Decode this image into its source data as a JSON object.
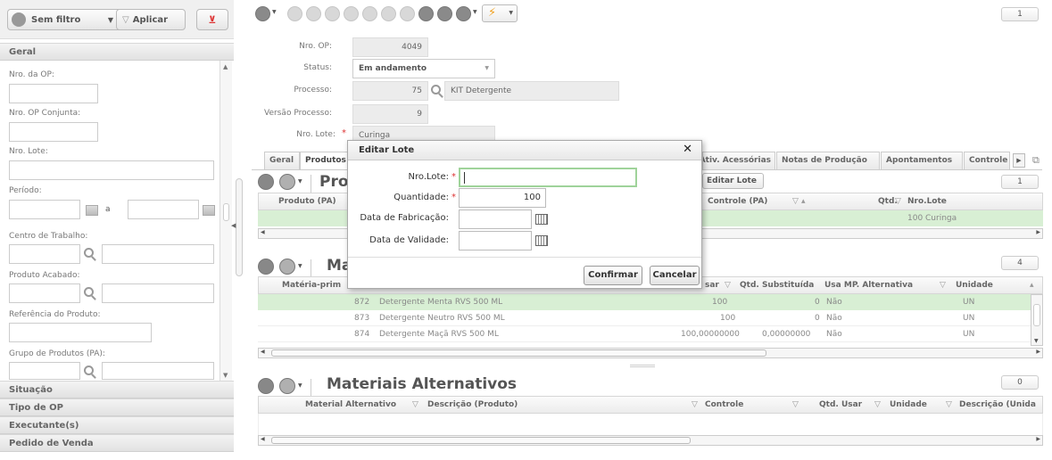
{
  "filter_bar": {
    "filter_label": "Sem filtro",
    "apply_label": "Aplicar"
  },
  "left_panel": {
    "geral_header": "Geral",
    "fields": {
      "nro_op": "Nro. da OP:",
      "nro_op_conjunta": "Nro. OP Conjunta:",
      "nro_lote": "Nro. Lote:",
      "periodo": "Período:",
      "periodo_sep": "a",
      "centro_trabalho": "Centro de Trabalho:",
      "produto_acabado": "Produto Acabado:",
      "referencia_produto": "Referência do Produto:",
      "grupo_produtos": "Grupo de Produtos (PA):"
    },
    "sections": [
      "Situação",
      "Tipo de OP",
      "Executante(s)",
      "Pedido de Venda"
    ]
  },
  "top_pager": "1",
  "form": {
    "nro_op_label": "Nro. OP:",
    "nro_op_value": "4049",
    "status_label": "Status:",
    "status_value": "Em andamento",
    "processo_label": "Processo:",
    "processo_value": "75",
    "processo_desc": "KIT Detergente",
    "versao_label": "Versão Processo:",
    "versao_value": "9",
    "nro_lote_label": "Nro. Lote:",
    "nro_lote_value": "Curinga"
  },
  "tabs": [
    "Geral",
    "Produtos",
    "Ativ. Acessórias",
    "Notas de Produção",
    "Apontamentos",
    "Controle"
  ],
  "produtos_grid": {
    "title": "Produtos",
    "title_visible": "Pro",
    "pager": "1",
    "edit_lote_label": "Editar Lote",
    "columns": [
      "Produto (PA)",
      "Controle (PA)",
      "Qtd.",
      "Nro.Lote"
    ],
    "rows": [
      {
        "qtd": "100",
        "lote": "Curinga"
      }
    ]
  },
  "materias_grid": {
    "title_visible": "Ma",
    "pager": "4",
    "columns": [
      "Matéria-prima",
      "Qtd. Usar",
      "Qtd. Substituída",
      "Usa MP. Alternativa",
      "Unidade"
    ],
    "col_visible": [
      "Matéria-prim",
      "sar"
    ],
    "rows": [
      {
        "code": "872",
        "desc": "Detergente Menta RVS 500 ML",
        "qtd": "100",
        "sub": "0",
        "alt": "Não",
        "un": "UN"
      },
      {
        "code": "873",
        "desc": "Detergente Neutro RVS 500 ML",
        "qtd": "100",
        "sub": "0",
        "alt": "Não",
        "un": "UN"
      },
      {
        "code": "874",
        "desc": "Detergente Maçã RVS 500 ML",
        "qtd": "100,00000000",
        "sub": "0,00000000",
        "alt": "Não",
        "un": "UN"
      }
    ]
  },
  "alternativos_grid": {
    "title": "Materiais Alternativos",
    "pager": "0",
    "columns": [
      "Material Alternativo",
      "Descrição (Produto)",
      "Controle",
      "Qtd. Usar",
      "Unidade",
      "Descrição (Unida"
    ]
  },
  "modal": {
    "title": "Editar Lote",
    "close": "✕",
    "nro_lote_label": "Nro.Lote:",
    "quantidade_label": "Quantidade:",
    "quantidade_value": "100",
    "fabricacao_label": "Data de Fabricação:",
    "validade_label": "Data de Validade:",
    "confirm_label": "Confirmar",
    "cancel_label": "Cancelar"
  },
  "colors": {
    "row_selected": "#d8efd4",
    "required": "#dd3333",
    "lightning": "#f0a020"
  }
}
